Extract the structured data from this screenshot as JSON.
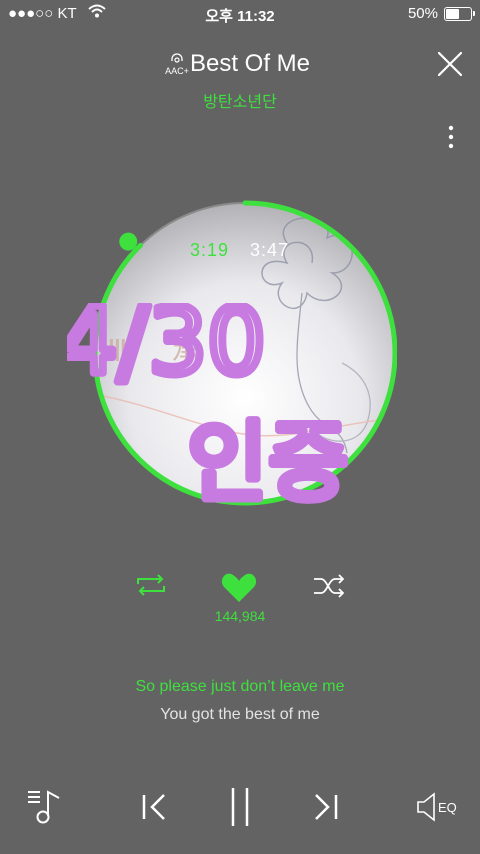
{
  "status_bar": {
    "carrier": "●●●○○ KT",
    "time": "오후 11:32",
    "battery": "50%"
  },
  "header": {
    "codec_badge": "AAC+",
    "title": "Best Of Me",
    "artist": "방탄소년단"
  },
  "player": {
    "time_current": "3:19",
    "time_total": "3:47",
    "overlay_text_line1": "4/30",
    "overlay_text_line2": "인증",
    "like_count": "144,984",
    "progress": 0.877
  },
  "lyrics": {
    "current": "So please just don’t leave me",
    "next": "You got the best of me"
  },
  "bottom_bar": {
    "eq_label": "EQ"
  },
  "colors": {
    "background": "#636363",
    "accent": "#3ee03e",
    "handwriting": "#c77be0"
  },
  "icons": [
    "wifi-icon",
    "battery-icon",
    "headphone-icon",
    "close-icon",
    "more-icon",
    "repeat-icon",
    "heart-icon",
    "shuffle-icon",
    "playlist-icon",
    "previous-icon",
    "pause-icon",
    "next-icon",
    "speaker-eq-icon"
  ]
}
